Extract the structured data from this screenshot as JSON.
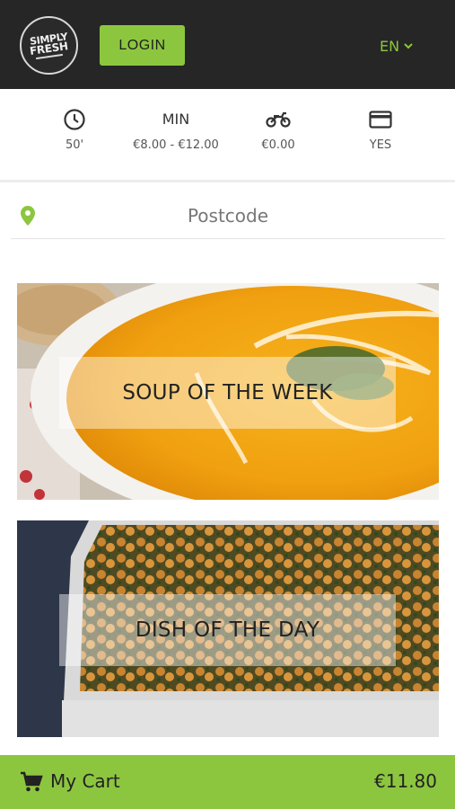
{
  "header": {
    "logo_line1": "SIMPLY",
    "logo_line2": "FRESH",
    "login_label": "LOGIN",
    "language": "EN"
  },
  "info": {
    "delivery_time": "50'",
    "min_title": "MIN",
    "min_order": "€8.00 - €12.00",
    "delivery_fee": "€0.00",
    "card_payment": "YES"
  },
  "postcode": {
    "placeholder": "Postcode"
  },
  "categories": [
    {
      "label": "SOUP OF THE WEEK"
    },
    {
      "label": "DISH OF THE DAY"
    }
  ],
  "cart": {
    "label": "My Cart",
    "total": "€11.80"
  },
  "colors": {
    "accent": "#8cc63f",
    "header_bg": "#262626"
  },
  "icons": [
    "clock-icon",
    "scooter-icon",
    "credit-card-icon",
    "location-pin-icon",
    "cart-icon",
    "chevron-down-icon"
  ]
}
